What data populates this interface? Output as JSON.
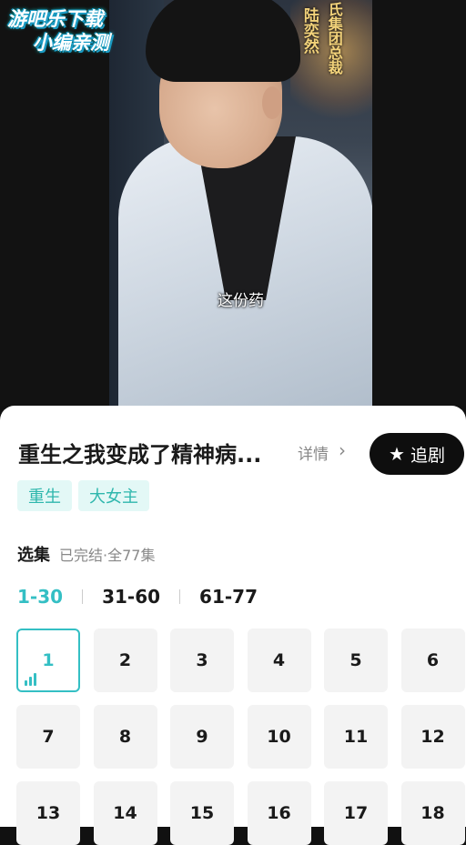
{
  "video": {
    "subtitle": "这份药",
    "calligraphy_left": "陆奕然",
    "calligraphy_right": "氏集团总裁",
    "watermark_line1": "游吧乐下载",
    "watermark_line2": "小编亲测"
  },
  "show": {
    "title": "重生之我变成了精神病...",
    "detail_label": "详情",
    "follow_label": "追剧",
    "tags": [
      "重生",
      "大女主"
    ]
  },
  "episodes": {
    "label": "选集",
    "status": "已完结·全77集",
    "ranges": [
      "1-30",
      "31-60",
      "61-77"
    ],
    "active_range": "1-30",
    "current": 1,
    "items": [
      "1",
      "2",
      "3",
      "4",
      "5",
      "6",
      "7",
      "8",
      "9",
      "10",
      "11",
      "12",
      "13",
      "14",
      "15",
      "16",
      "17",
      "18"
    ]
  },
  "colors": {
    "accent": "#34bfc4",
    "tag_bg": "#e3f8f6",
    "tag_text": "#2fb7ad",
    "button_bg": "#0e0e0e"
  }
}
